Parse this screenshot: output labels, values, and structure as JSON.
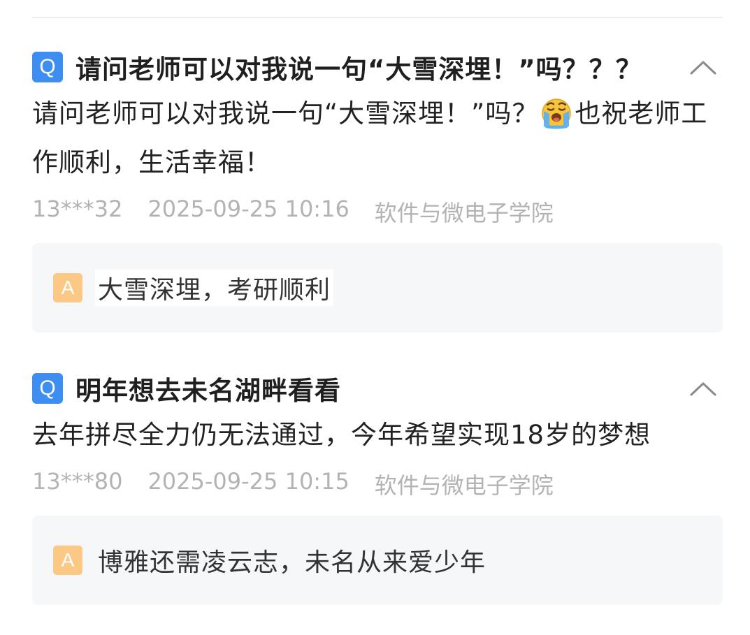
{
  "qa_list": [
    {
      "q_badge": "Q",
      "title": "请问老师可以对我说一句“大雪深埋！”吗？？？",
      "body_before_emoji": "请问老师可以对我说一句“大雪深埋！”吗？",
      "emoji": "loudly-crying-face",
      "body_after_emoji": "也祝老师工作顺利，生活幸福！",
      "user": "13***32",
      "time": "2025-09-25 10:16",
      "department": "软件与微电子学院",
      "a_badge": "A",
      "answer": "大雪深埋，考研顺利"
    },
    {
      "q_badge": "Q",
      "title": "明年想去未名湖畔看看",
      "body": "去年拼尽全力仍无法通过，今年希望实现18岁的梦想",
      "user": "13***80",
      "time": "2025-09-25 10:15",
      "department": "软件与微电子学院",
      "a_badge": "A",
      "answer": "博雅还需凌云志，未名从来爱少年"
    }
  ],
  "colors": {
    "q_badge": "#3d8ef0",
    "a_badge": "#fbc985",
    "meta_text": "#b3b3b3",
    "answer_bg": "#f6f7f9"
  },
  "icons": {
    "collapse": "chevron-up-icon"
  }
}
